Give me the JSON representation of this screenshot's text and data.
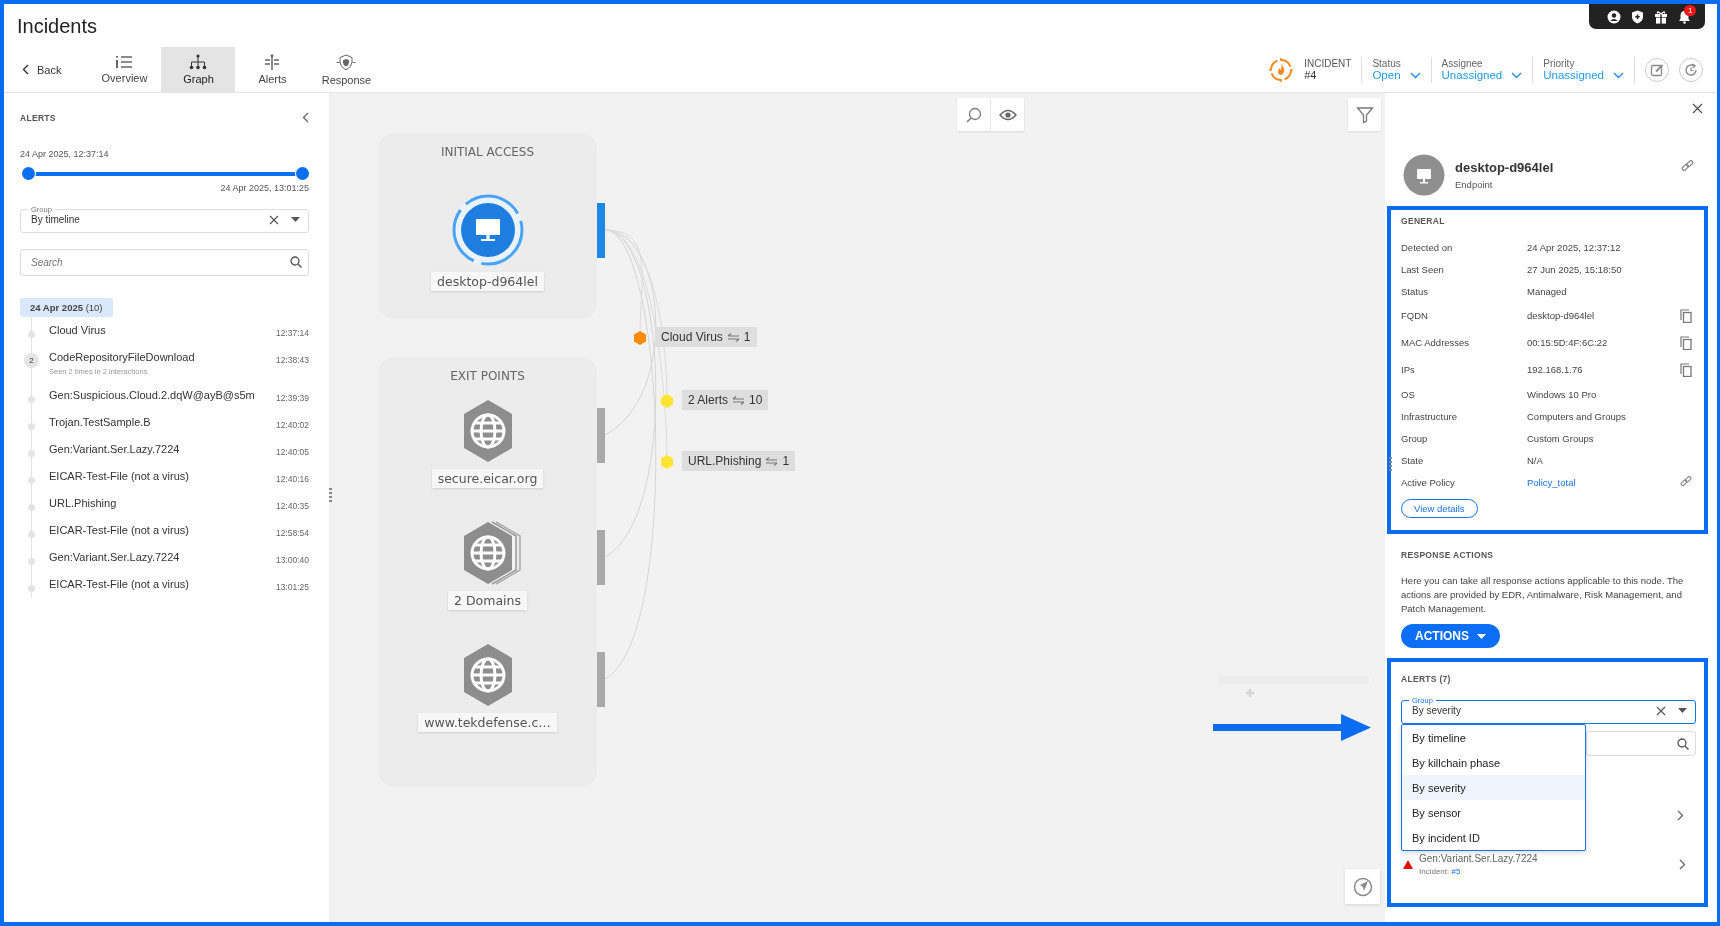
{
  "page_title": "Incidents",
  "nav": {
    "back": "Back",
    "tabs": [
      {
        "label": "Overview",
        "kind": "list",
        "selected": false
      },
      {
        "label": "Graph",
        "kind": "tree",
        "selected": true
      },
      {
        "label": "Alerts",
        "kind": "alerts",
        "selected": false
      },
      {
        "label": "Response",
        "kind": "shield",
        "selected": false
      }
    ]
  },
  "notifications": {
    "badge": "1"
  },
  "incident": {
    "label": "INCIDENT",
    "number": "#4"
  },
  "fields": [
    {
      "label": "Status",
      "value": "Open"
    },
    {
      "label": "Assignee",
      "value": "Unassigned"
    },
    {
      "label": "Priority",
      "value": "Unassigned"
    }
  ],
  "alerts_panel": {
    "title": "ALERTS",
    "range_start": "24 Apr 2025, 12:37:14",
    "range_end": "24 Apr 2025, 13:01:25",
    "level": 1,
    "group": {
      "label": "Group",
      "value": "By timeline"
    },
    "search": {
      "placeholder": "Search"
    },
    "date_group": {
      "date": "24 Apr 2025",
      "count": "(10)"
    },
    "items": [
      {
        "name": "Cloud Virus",
        "time": "12:37:14"
      },
      {
        "name": "CodeRepositoryFileDownload",
        "time": "12:38:43",
        "count": "2",
        "note": "Seen 2 times in 2 interactions"
      },
      {
        "name": "Gen:Suspicious.Cloud.2.dqW@ayB@s5m",
        "time": "12:39:39"
      },
      {
        "name": "Trojan.TestSample.B",
        "time": "12:40:02"
      },
      {
        "name": "Gen:Variant.Ser.Lazy.7224",
        "time": "12:40:05"
      },
      {
        "name": "EICAR-Test-File (not a virus)",
        "time": "12:40:16"
      },
      {
        "name": "URL.Phishing",
        "time": "12:40:35"
      },
      {
        "name": "EICAR-Test-File (not a virus)",
        "time": "12:58:54"
      },
      {
        "name": "Gen:Variant.Ser.Lazy.7224",
        "time": "13:00:40"
      },
      {
        "name": "EICAR-Test-File (not a virus)",
        "time": "13:01:25"
      }
    ]
  },
  "graph": {
    "stages": [
      {
        "title": "INITIAL ACCESS",
        "nodes": [
          {
            "kind": "endpoint",
            "label": "desktop-d964lel",
            "selected": true
          }
        ]
      },
      {
        "title": "EXIT POINTS",
        "nodes": [
          {
            "kind": "domain",
            "label": "secure.eicar.org",
            "selected": false
          },
          {
            "kind": "domains",
            "label": "2 Domains",
            "selected": false
          },
          {
            "kind": "domain",
            "label": "www.tekdefense.c…",
            "selected": false
          }
        ]
      }
    ],
    "alerts": [
      {
        "label": "Cloud Virus",
        "count": "1",
        "color": "#ff8c00"
      },
      {
        "label": "2 Alerts",
        "count": "10",
        "color": "#ffe433"
      },
      {
        "label": "URL.Phishing",
        "count": "1",
        "color": "#ffe433"
      }
    ]
  },
  "details": {
    "name": "desktop-d964lel",
    "type": "Endpoint",
    "general": {
      "title": "GENERAL",
      "rows": [
        {
          "label": "Detected on",
          "value": "24 Apr 2025, 12:37:12",
          "kind": "text"
        },
        {
          "label": "Last Seen",
          "value": "27 Jun 2025, 15:18:50",
          "kind": "text"
        },
        {
          "label": "Status",
          "value": "Managed",
          "kind": "text"
        },
        {
          "label": "FQDN",
          "value": "desktop-d964lel",
          "kind": "copy"
        },
        {
          "label": "MAC Addresses",
          "value": "00:15:5D:4F:6C:22",
          "kind": "copy"
        },
        {
          "label": "IPs",
          "value": "192.168.1.76",
          "kind": "copy"
        },
        {
          "label": "OS",
          "value": "Windows 10 Pro",
          "kind": "text"
        },
        {
          "label": "Infrastructure",
          "value": "Computers and Groups",
          "kind": "text"
        },
        {
          "label": "Group",
          "value": "Custom Groups",
          "kind": "text"
        },
        {
          "label": "State",
          "value": "N/A",
          "kind": "text"
        },
        {
          "label": "Active Policy",
          "value": "Policy_total",
          "kind": "link"
        }
      ],
      "button": "View details"
    },
    "response": {
      "title": "RESPONSE ACTIONS",
      "text": "Here you can take all response actions applicable to this node. The actions are provided by EDR, Antimalware, Risk Management, and Patch Management.",
      "button": "ACTIONS"
    },
    "alerts": {
      "title": "ALERTS (7)",
      "group": {
        "label": "Group",
        "value": "By severity"
      },
      "options": [
        {
          "label": "By timeline",
          "selected": false
        },
        {
          "label": "By killchain phase",
          "selected": false
        },
        {
          "label": "By severity",
          "selected": true
        },
        {
          "label": "By sensor",
          "selected": false
        },
        {
          "label": "By incident ID",
          "selected": false
        }
      ],
      "item": {
        "name": "Gen:Variant.Ser.Lazy.7224",
        "incident_label": "Incident:",
        "incident": "#5"
      }
    }
  }
}
